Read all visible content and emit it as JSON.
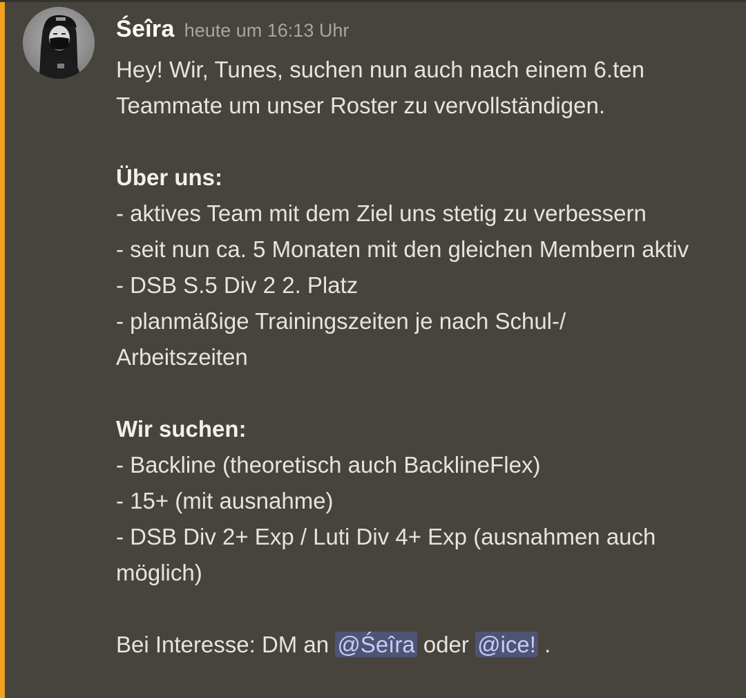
{
  "message": {
    "username": "Śeîra",
    "timestamp": "heute um 16:13 Uhr",
    "intro": "Hey! Wir, Tunes, suchen nun auch nach einem 6.ten Teammate um unser Roster zu vervollständigen.",
    "about_heading": "Über uns:",
    "about_items": [
      "- aktives Team mit dem Ziel uns stetig zu verbessern",
      "- seit nun ca. 5 Monaten mit den gleichen Membern aktiv",
      "- DSB S.5 Div 2 2. Platz",
      "- planmäßige Trainingszeiten je nach Schul-/ Arbeitszeiten"
    ],
    "search_heading": "Wir suchen:",
    "search_items": [
      "- Backline (theoretisch auch BacklineFlex)",
      "- 15+ (mit ausnahme)",
      "- DSB Div 2+ Exp / Luti Div 4+ Exp (ausnahmen auch möglich)"
    ],
    "contact_prefix": "Bei Interesse: DM an ",
    "mention_1": "@Śeîra",
    "contact_middle": " oder ",
    "mention_2": "@ice!",
    "contact_suffix": " ."
  },
  "colors": {
    "background": "#47443d",
    "accent_bar": "#f0a01e",
    "mention_bg": "#4f5473",
    "mention_text": "#c6cbff"
  },
  "icons": {
    "avatar": "user-avatar-image"
  }
}
